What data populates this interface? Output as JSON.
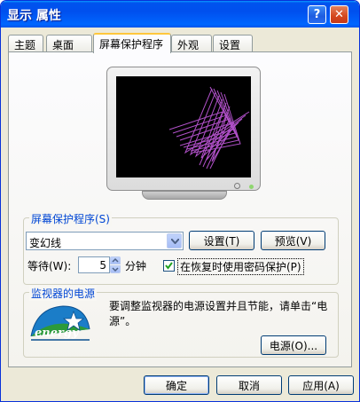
{
  "window": {
    "title": "显示 属性",
    "help_label": "?",
    "close_label": "✕"
  },
  "tabs": [
    {
      "label": "主题"
    },
    {
      "label": "桌面"
    },
    {
      "label": "屏幕保护程序"
    },
    {
      "label": "外观"
    },
    {
      "label": "设置"
    }
  ],
  "active_tab": "屏幕保护程序",
  "screensaver": {
    "group_label": "屏幕保护程序(S)",
    "selected": "变幻线",
    "settings_button": "设置(T)",
    "preview_button": "预览(V)",
    "wait_label": "等待(W):",
    "wait_value": "5",
    "minutes_label": "分钟",
    "password_checked": true,
    "password_label": "在恢复时使用密码保护(P)"
  },
  "power": {
    "group_label": "监视器的电源",
    "description": "要调整监视器的电源设置并且节能，请单击“电源”。",
    "power_button": "电源(O)...",
    "logo_text": "energy"
  },
  "footer": {
    "ok_label": "确定",
    "cancel_label": "取消",
    "apply_label": "应用(A)"
  },
  "colors": {
    "titlebar": "#0054e3",
    "group_label": "#0046d5",
    "active_tab_accent": "#ffc73c",
    "screensaver_lines": "#b050c8"
  },
  "icons": {
    "close": "close-icon",
    "help": "help-icon",
    "dropdown": "chevron-down-icon",
    "spin_up": "spin-up-icon",
    "spin_down": "spin-down-icon",
    "checkmark": "checkmark-icon",
    "energy_star": "energy-star-logo"
  }
}
